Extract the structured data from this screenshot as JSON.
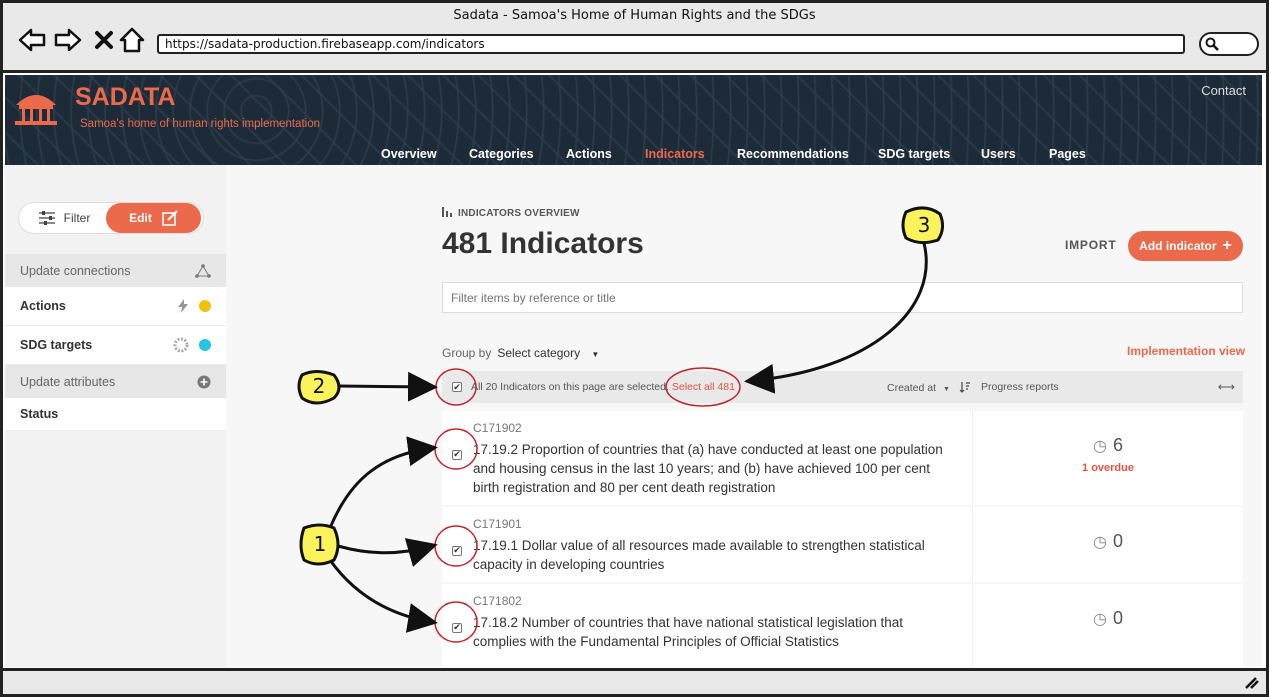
{
  "browser": {
    "window_title": "Sadata - Samoa's Home of Human Rights and the SDGs",
    "url": "https://sadata-production.firebaseapp.com/indicators"
  },
  "header": {
    "brand": "SADATA",
    "tagline": "Samoa's home of human rights implementation",
    "contact": "Contact",
    "nav": [
      "Overview",
      "Categories",
      "Actions",
      "Indicators",
      "Recommendations",
      "SDG targets",
      "Users",
      "Pages"
    ],
    "active_nav": "Indicators"
  },
  "sidebar": {
    "filter_label": "Filter",
    "edit_label": "Edit",
    "update_connections": "Update connections",
    "actions": "Actions",
    "sdg_targets": "SDG targets",
    "update_attributes": "Update attributes",
    "status": "Status"
  },
  "main": {
    "overview_label": "INDICATORS OVERVIEW",
    "title": "481 Indicators",
    "import_label": "IMPORT",
    "add_label": "Add indicator",
    "filter_placeholder": "Filter items by reference or title",
    "group_by_label": "Group by",
    "group_by_value": "Select category",
    "implementation_view": "Implementation view",
    "selection_text": "All 20 Indicators on this page are selected.",
    "select_all": "Select all 481",
    "created_at": "Created at",
    "progress_reports": "Progress reports"
  },
  "rows": [
    {
      "code": "C171902",
      "desc": "17.19.2 Proportion of countries that (a) have conducted at least one population and housing census in the last 10 years; and (b) have achieved 100 per cent birth registration and 80 per cent death registration",
      "count": "6",
      "overdue": "1 overdue"
    },
    {
      "code": "C171901",
      "desc": "17.19.1 Dollar value of all resources made available to strengthen statistical capacity in developing countries",
      "count": "0",
      "overdue": ""
    },
    {
      "code": "C171802",
      "desc": "17.18.2 Number of countries that have national statistical legislation that complies with the Fundamental Principles of Official Statistics",
      "count": "0",
      "overdue": ""
    }
  ],
  "annotations": {
    "one": "1",
    "two": "2",
    "three": "3"
  },
  "colors": {
    "accent": "#ec6a4c",
    "header_bg": "#1d2b38",
    "annotation_circle": "#c0272d",
    "callout_fill": "#fbf35b"
  }
}
